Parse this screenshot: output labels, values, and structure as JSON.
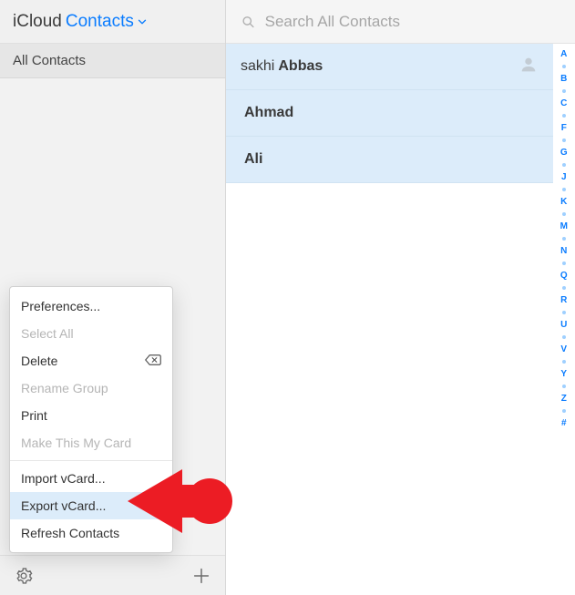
{
  "header": {
    "brand": "iCloud",
    "app_name": "Contacts"
  },
  "sidebar": {
    "groups": [
      {
        "label": "All Contacts"
      }
    ]
  },
  "search": {
    "placeholder": "Search All Contacts"
  },
  "contacts": [
    {
      "first": "sakhi",
      "last": "Abbas",
      "avatar": true
    },
    {
      "first": "",
      "last": "Ahmad",
      "avatar": false
    },
    {
      "first": "",
      "last": "Ali",
      "avatar": false
    }
  ],
  "index_letters": [
    "A",
    "B",
    "C",
    "F",
    "G",
    "J",
    "K",
    "M",
    "N",
    "Q",
    "R",
    "U",
    "V",
    "Y",
    "Z",
    "#"
  ],
  "menu": {
    "items": [
      {
        "label": "Preferences...",
        "disabled": false
      },
      {
        "label": "Select All",
        "disabled": true
      },
      {
        "label": "Delete",
        "disabled": false,
        "backspace": true
      },
      {
        "label": "Rename Group",
        "disabled": true
      },
      {
        "label": "Print",
        "disabled": false
      },
      {
        "label": "Make This My Card",
        "disabled": true
      },
      {
        "sep": true
      },
      {
        "label": "Import vCard...",
        "disabled": false
      },
      {
        "label": "Export vCard...",
        "disabled": false,
        "selected": true
      },
      {
        "label": "Refresh Contacts",
        "disabled": false
      }
    ]
  }
}
